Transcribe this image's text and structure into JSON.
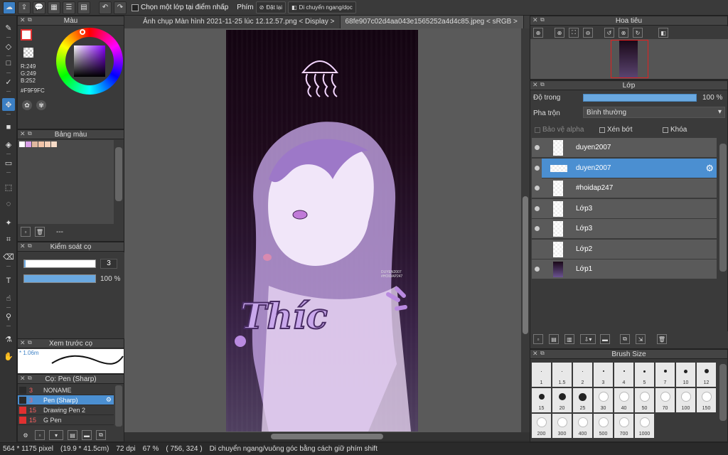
{
  "toolbar": {
    "select_layer_on_click": "Chọn một lớp tại điểm nhấp",
    "keys_label": "Phím",
    "reset_label": "Đặt lại",
    "flip_label": "Di chuyển ngang/dọc"
  },
  "tabs": [
    {
      "label": "Ảnh chụp Màn hình 2021-11-25 lúc 12.12.57.png < Display >"
    },
    {
      "label": "68fe907c02d4aa043e1565252a4d4c85.jpeg < sRGB >"
    }
  ],
  "color_panel": {
    "title": "Màu",
    "r": "R:249",
    "g": "G:249",
    "b": "B:252",
    "hex": "#F9F9FC"
  },
  "palette_panel": {
    "title": "Bảng màu",
    "swatches": [
      "#ffffff",
      "#d9a0e8",
      "#e0b8a0",
      "#f2c4a8",
      "#f5d0b8",
      "#f8dcc8"
    ],
    "footer": "---"
  },
  "brush_control": {
    "title": "Kiểm soát cọ",
    "size_value": "3",
    "opacity_value": "100 %",
    "size_fraction": 0.02,
    "opacity_fraction": 1.0
  },
  "brush_preview": {
    "title": "Xem trước cọ",
    "size_text": "* 1.06m"
  },
  "brush_list": {
    "title": "Cọ: Pen (Sharp)",
    "items": [
      {
        "size": "3",
        "name": "NONAME",
        "color": "#2a2a2a"
      },
      {
        "size": "3",
        "name": "Pen (Sharp)",
        "color": "#2a2a2a"
      },
      {
        "size": "15",
        "name": "Drawing Pen 2",
        "color": "#e03030"
      },
      {
        "size": "15",
        "name": "G Pen",
        "color": "#e03030"
      }
    ]
  },
  "navigator": {
    "title": "Hoa tiêu"
  },
  "layers_panel": {
    "title": "Lớp",
    "opacity_label": "Độ trong",
    "opacity_value": "100 %",
    "blend_label": "Pha trộn",
    "blend_value": "Bình thường",
    "protect_alpha": "Bảo vệ alpha",
    "clipping": "Xén bớt",
    "lock": "Khóa",
    "layers": [
      {
        "name": "duyen2007",
        "selected": false,
        "visible": true
      },
      {
        "name": "duyen2007",
        "selected": true,
        "visible": true
      },
      {
        "name": "#hoidap247",
        "selected": false,
        "visible": true
      },
      {
        "name": "Lớp3",
        "selected": false,
        "visible": true
      },
      {
        "name": "Lớp3",
        "selected": false,
        "visible": true
      },
      {
        "name": "Lớp2",
        "selected": false,
        "visible": false
      },
      {
        "name": "Lớp1",
        "selected": false,
        "visible": true
      }
    ]
  },
  "brush_size_panel": {
    "title": "Brush Size",
    "sizes": [
      "1",
      "1.5",
      "2",
      "3",
      "4",
      "5",
      "7",
      "10",
      "12",
      "15",
      "20",
      "25",
      "30",
      "40",
      "50",
      "70",
      "100",
      "150",
      "200",
      "300",
      "400",
      "500",
      "700",
      "1000"
    ]
  },
  "status": {
    "pixels": "564 * 1175 pixel",
    "physical": "(19.9 * 41.5cm)",
    "dpi": "72 dpi",
    "zoom": "67 %",
    "coords": "( 756, 324 )",
    "hint": "Di chuyển ngang/vuông góc bằng cách giữ phím shift"
  },
  "artwork": {
    "signature": "DUYEN2007\n#HOIDAP247",
    "lettering": "Thíc",
    "accent": "#b98ae0"
  }
}
